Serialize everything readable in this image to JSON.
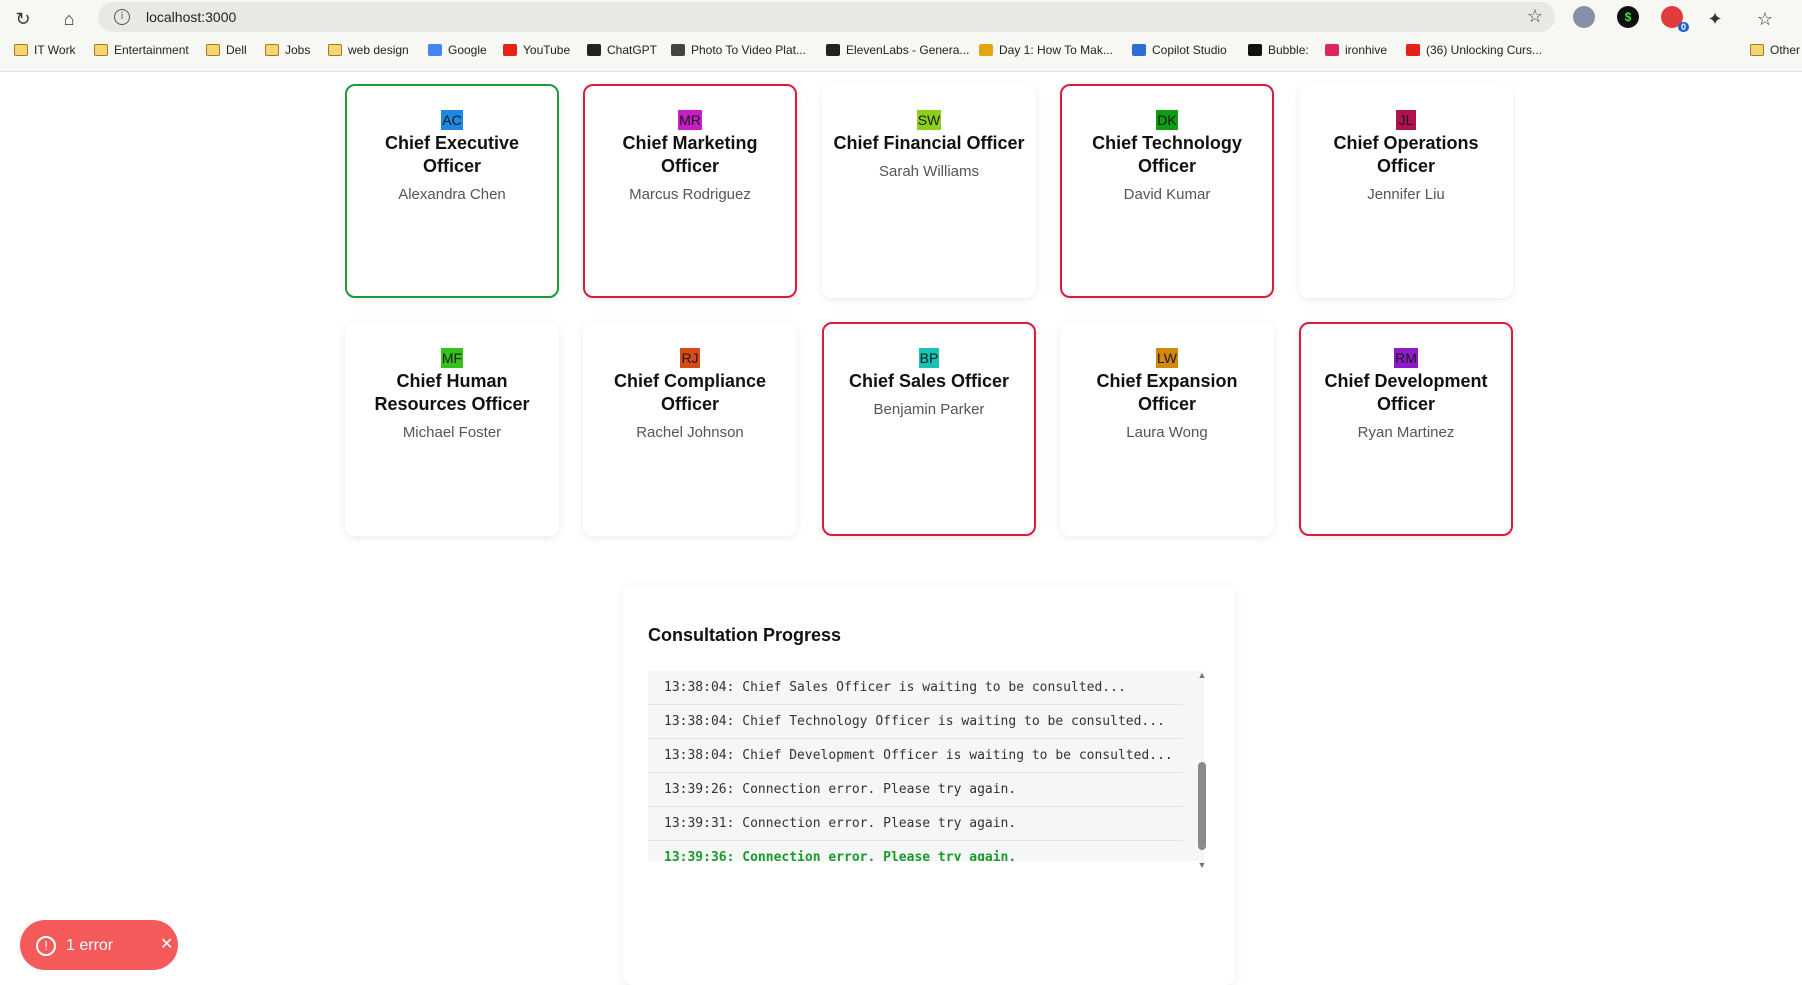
{
  "browser": {
    "url": "localhost:3000",
    "bookmarks": [
      {
        "label": "IT Work",
        "icon": "folder-icon"
      },
      {
        "label": "Entertainment",
        "icon": "folder-icon"
      },
      {
        "label": "Dell",
        "icon": "folder-icon"
      },
      {
        "label": "Jobs",
        "icon": "folder-icon"
      },
      {
        "label": "web design",
        "icon": "folder-icon"
      },
      {
        "label": "Google",
        "icon": "google-icon"
      },
      {
        "label": "YouTube",
        "icon": "youtube-icon"
      },
      {
        "label": "ChatGPT",
        "icon": "chatgpt-icon"
      },
      {
        "label": "Photo To Video Plat...",
        "icon": "pause-icon"
      },
      {
        "label": "ElevenLabs - Genera...",
        "icon": "elevenlabs-icon"
      },
      {
        "label": "Day 1: How To Mak...",
        "icon": "claude-icon"
      },
      {
        "label": "Copilot Studio",
        "icon": "copilot-icon"
      },
      {
        "label": "Bubble:",
        "icon": "bubble-icon"
      },
      {
        "label": "ironhive",
        "icon": "ironhive-icon"
      },
      {
        "label": "(36) Unlocking Curs...",
        "icon": "youtube-icon"
      },
      {
        "label": "Other",
        "icon": "folder-icon"
      }
    ],
    "extension_badge": "0"
  },
  "officers": [
    {
      "initials": "AC",
      "color": "#1e88e5",
      "role": "Chief Executive Officer",
      "name": "Alexandra Chen",
      "state": "active"
    },
    {
      "initials": "MR",
      "color": "#c51ec5",
      "role": "Chief Marketing Officer",
      "name": "Marcus Rodriguez",
      "state": "waiting"
    },
    {
      "initials": "SW",
      "color": "#8bd11a",
      "role": "Chief Financial Officer",
      "name": "Sarah Williams",
      "state": "idle"
    },
    {
      "initials": "DK",
      "color": "#0f9d14",
      "role": "Chief Technology Officer",
      "name": "David Kumar",
      "state": "waiting"
    },
    {
      "initials": "JL",
      "color": "#b0114f",
      "role": "Chief Operations Officer",
      "name": "Jennifer Liu",
      "state": "idle"
    },
    {
      "initials": "MF",
      "color": "#35c21a",
      "role": "Chief Human Resources Officer",
      "name": "Michael Foster",
      "state": "idle"
    },
    {
      "initials": "RJ",
      "color": "#d84a16",
      "role": "Chief Compliance Officer",
      "name": "Rachel Johnson",
      "state": "idle"
    },
    {
      "initials": "BP",
      "color": "#16c3b4",
      "role": "Chief Sales Officer",
      "name": "Benjamin Parker",
      "state": "waiting"
    },
    {
      "initials": "LW",
      "color": "#d4880e",
      "role": "Chief Expansion Officer",
      "name": "Laura Wong",
      "state": "idle"
    },
    {
      "initials": "RM",
      "color": "#8e1ac9",
      "role": "Chief Development Officer",
      "name": "Ryan Martinez",
      "state": "waiting"
    }
  ],
  "progress": {
    "title": "Consultation Progress",
    "log": [
      "13:38:04: Chief Sales Officer is waiting to be consulted...",
      "13:38:04: Chief Technology Officer is waiting to be consulted...",
      "13:38:04: Chief Development Officer is waiting to be consulted...",
      "13:39:26: Connection error. Please try again.",
      "13:39:31: Connection error. Please try again.",
      "13:39:36: Connection error. Please try again."
    ]
  },
  "error_toast": {
    "label": "1 error"
  }
}
